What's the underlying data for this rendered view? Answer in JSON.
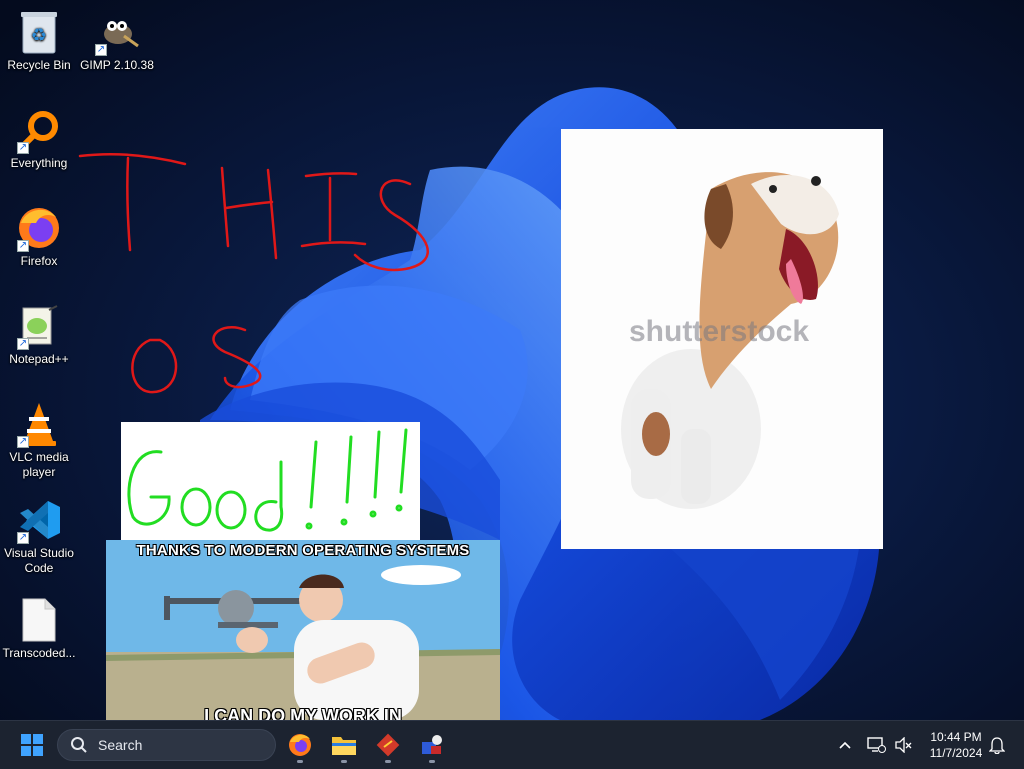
{
  "desktop": {
    "icons": [
      {
        "label": "Recycle Bin",
        "icon": "recycle-bin-icon"
      },
      {
        "label": "GIMP 2.10.38",
        "icon": "gimp-icon"
      },
      {
        "label": "Everything",
        "icon": "everything-search-icon"
      },
      {
        "label": "Firefox",
        "icon": "firefox-icon"
      },
      {
        "label": "Notepad++",
        "icon": "notepad-plus-plus-icon"
      },
      {
        "label": "VLC media player",
        "icon": "vlc-icon"
      },
      {
        "label": "Visual Studio Code",
        "icon": "vscode-icon"
      },
      {
        "label": "Transcoded...",
        "icon": "file-icon"
      }
    ],
    "drawing": {
      "strokes_color": "#e01818"
    },
    "pasted": {
      "note_color": "#22dd22",
      "watermark": "shutterstock",
      "meme_top": "THANKS TO MODERN OPERATING SYSTEMS",
      "meme_bottom": "I CAN DO MY WORK IN"
    }
  },
  "taskbar": {
    "search_placeholder": "Search",
    "apps": [
      "start-icon",
      "firefox-icon",
      "file-explorer-icon",
      "app-red-icon",
      "app-blue-icon"
    ],
    "clock": {
      "time": "10:44 PM",
      "date": "11/7/2024"
    }
  },
  "colors": {
    "taskbar": "#1c2330",
    "accent": "#0a6cff"
  }
}
